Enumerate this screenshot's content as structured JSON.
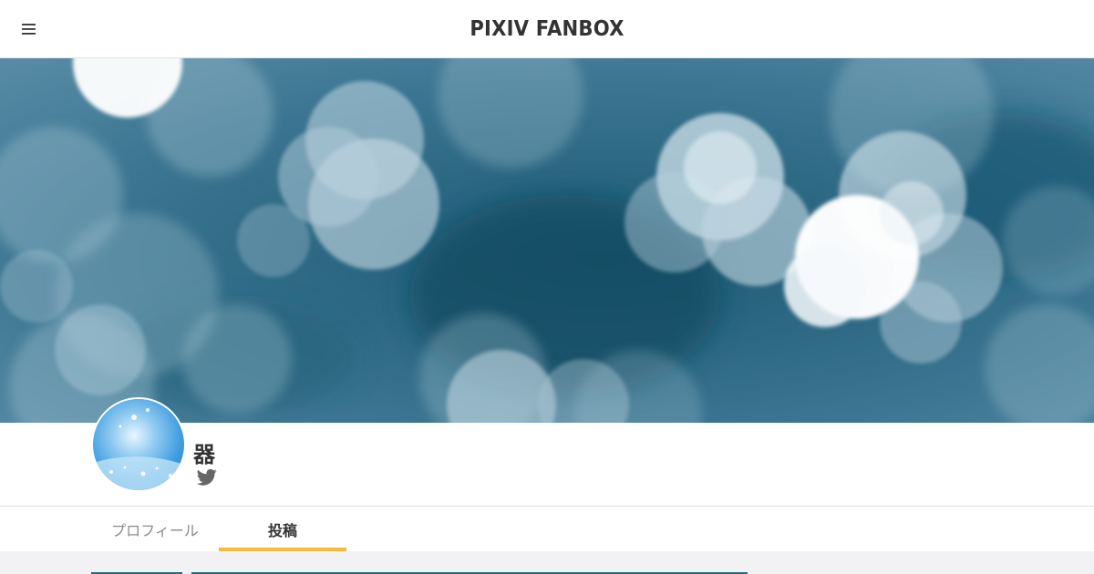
{
  "header": {
    "logo_text": "PIXIV FANBOX",
    "menu_icon": "hamburger-menu-icon"
  },
  "cover": {
    "description_icon": "bokeh-cover-image"
  },
  "creator": {
    "name": "器",
    "social_icon": "twitter-icon"
  },
  "tabs": [
    {
      "label": "プロフィール",
      "active": false
    },
    {
      "label": "投稿",
      "active": true
    }
  ],
  "colors": {
    "accent": "#f7b93a",
    "text": "#333333",
    "muted": "#8a8a8a",
    "cover_base": "#2f6a86"
  }
}
